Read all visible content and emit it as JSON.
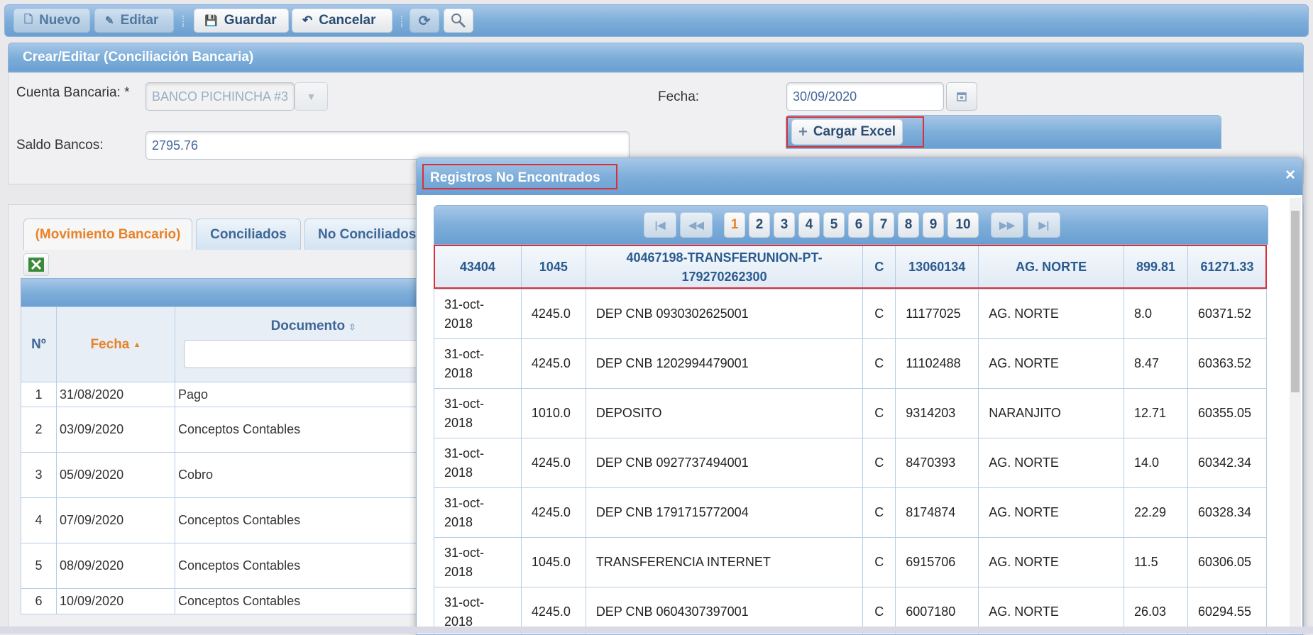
{
  "toolbar": {
    "nuevo": "Nuevo",
    "editar": "Editar",
    "guardar": "Guardar",
    "cancelar": "Cancelar"
  },
  "panel": {
    "title": "Crear/Editar (Conciliación Bancaria)"
  },
  "form": {
    "cuenta_label": "Cuenta Bancaria: *",
    "cuenta_value": "BANCO PICHINCHA #3",
    "fecha_label": "Fecha:",
    "fecha_value": "30/09/2020",
    "saldo_label": "Saldo Bancos:",
    "saldo_value": "2795.76",
    "cargar_excel": "Cargar Excel"
  },
  "tabs": [
    "(Movimiento Bancario)",
    "Conciliados",
    "No Conciliados"
  ],
  "grid": {
    "col_no": "Nº",
    "col_fecha": "Fecha",
    "col_documento": "Documento",
    "rows": [
      {
        "n": "1",
        "fecha": "31/08/2020",
        "doc": "Pago"
      },
      {
        "n": "2",
        "fecha": "03/09/2020",
        "doc": "Conceptos Contables"
      },
      {
        "n": "3",
        "fecha": "05/09/2020",
        "doc": "Cobro"
      },
      {
        "n": "4",
        "fecha": "07/09/2020",
        "doc": "Conceptos Contables"
      },
      {
        "n": "5",
        "fecha": "08/09/2020",
        "doc": "Conceptos Contables"
      },
      {
        "n": "6",
        "fecha": "10/09/2020",
        "doc": "Conceptos Contables"
      }
    ]
  },
  "dialog": {
    "title": "Registros No Encontrados",
    "close": "×",
    "pages": [
      "1",
      "2",
      "3",
      "4",
      "5",
      "6",
      "7",
      "8",
      "9",
      "10"
    ],
    "current_page": "1",
    "header_row": [
      "43404",
      "1045",
      "40467198-TRANSFERUNION-PT-179270262300",
      "C",
      "13060134",
      "AG. NORTE",
      "899.81",
      "61271.33"
    ],
    "rows": [
      [
        "31-oct-2018",
        "4245.0",
        "DEP CNB 0930302625001",
        "C",
        "11177025",
        "AG. NORTE",
        "8.0",
        "60371.52"
      ],
      [
        "31-oct-2018",
        "4245.0",
        "DEP CNB 1202994479001",
        "C",
        "11102488",
        "AG. NORTE",
        "8.47",
        "60363.52"
      ],
      [
        "31-oct-2018",
        "1010.0",
        "DEPOSITO",
        "C",
        "9314203",
        "NARANJITO",
        "12.71",
        "60355.05"
      ],
      [
        "31-oct-2018",
        "4245.0",
        "DEP CNB 0927737494001",
        "C",
        "8470393",
        "AG. NORTE",
        "14.0",
        "60342.34"
      ],
      [
        "31-oct-2018",
        "4245.0",
        "DEP CNB 1791715772004",
        "C",
        "8174874",
        "AG. NORTE",
        "22.29",
        "60328.34"
      ],
      [
        "31-oct-2018",
        "1045.0",
        "TRANSFERENCIA INTERNET",
        "C",
        "6915706",
        "AG. NORTE",
        "11.5",
        "60306.05"
      ],
      [
        "31-oct-2018",
        "4245.0",
        "DEP CNB 0604307397001",
        "C",
        "6007180",
        "AG. NORTE",
        "26.03",
        "60294.55"
      ]
    ]
  },
  "colors": {
    "accent": "#e8822a",
    "header_blue": "#6a9fd2",
    "highlight": "#d9303a"
  },
  "icons": [
    "new-icon",
    "edit-icon",
    "save-icon",
    "undo-icon",
    "refresh-icon",
    "search-icon",
    "calendar-icon",
    "plus-icon",
    "excel-icon",
    "sort-asc-icon",
    "sort-both-icon",
    "close-icon"
  ]
}
